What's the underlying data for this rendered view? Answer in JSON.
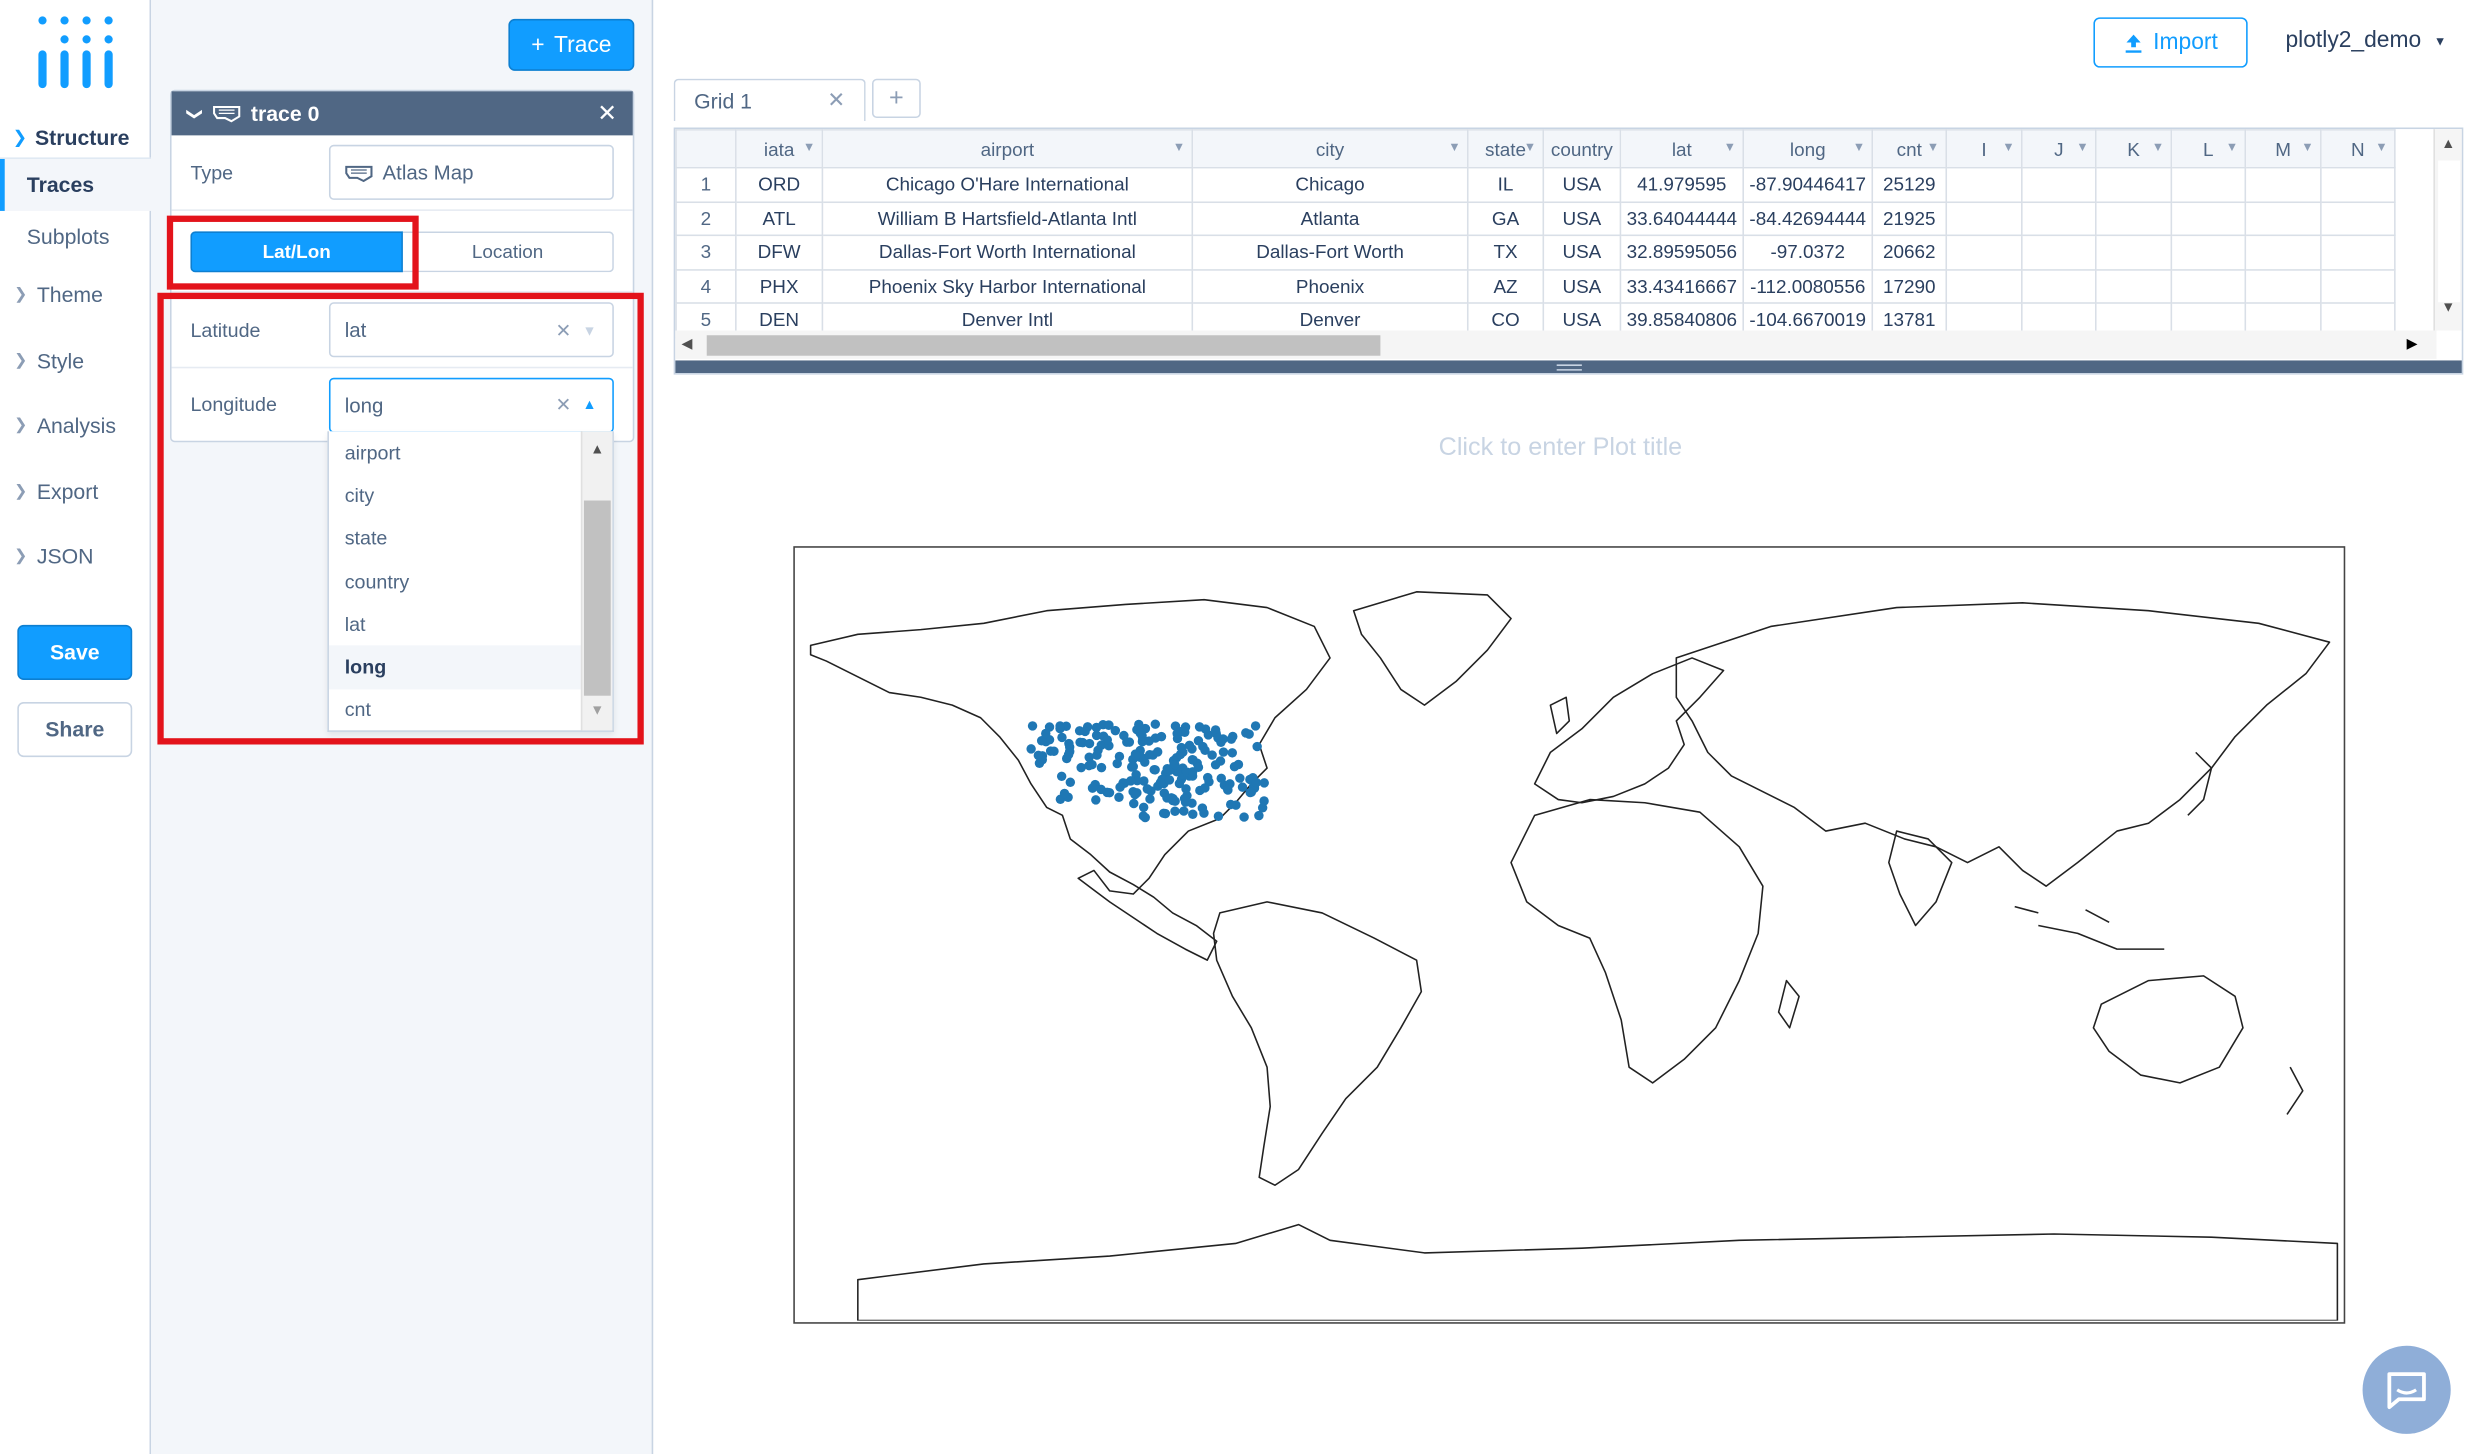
{
  "nav": {
    "structure_label": "Structure",
    "traces_label": "Traces",
    "subplots_label": "Subplots",
    "items": [
      {
        "label": "Theme"
      },
      {
        "label": "Style"
      },
      {
        "label": "Analysis"
      },
      {
        "label": "Export"
      },
      {
        "label": "JSON"
      }
    ],
    "save_label": "Save",
    "share_label": "Share"
  },
  "panel": {
    "add_trace_label": "Trace",
    "trace_title": "trace 0",
    "type_label": "Type",
    "type_value": "Atlas Map",
    "mode_on": "Lat/Lon",
    "mode_off": "Location",
    "latitude_label": "Latitude",
    "latitude_value": "lat",
    "longitude_label": "Longitude",
    "longitude_value": "long",
    "options": [
      "airport",
      "city",
      "state",
      "country",
      "lat",
      "long",
      "cnt"
    ],
    "selected_option": "long"
  },
  "topbar": {
    "import_label": "Import",
    "user_label": "plotly2_demo"
  },
  "grid": {
    "tab_label": "Grid 1",
    "columns": [
      "iata",
      "airport",
      "city",
      "state",
      "country",
      "lat",
      "long",
      "cnt",
      "I",
      "J",
      "K",
      "L",
      "M",
      "N"
    ],
    "rows": [
      [
        "1",
        "ORD",
        "Chicago O'Hare International",
        "Chicago",
        "IL",
        "USA",
        "41.979595",
        "-87.90446417",
        "25129"
      ],
      [
        "2",
        "ATL",
        "William B Hartsfield-Atlanta Intl",
        "Atlanta",
        "GA",
        "USA",
        "33.64044444",
        "-84.42694444",
        "21925"
      ],
      [
        "3",
        "DFW",
        "Dallas-Fort Worth International",
        "Dallas-Fort Worth",
        "TX",
        "USA",
        "32.89595056",
        "-97.0372",
        "20662"
      ],
      [
        "4",
        "PHX",
        "Phoenix Sky Harbor International",
        "Phoenix",
        "AZ",
        "USA",
        "33.43416667",
        "-112.0080556",
        "17290"
      ],
      [
        "5",
        "DEN",
        "Denver Intl",
        "Denver",
        "CO",
        "USA",
        "39.85840806",
        "-104.6670019",
        "13781"
      ]
    ]
  },
  "plot": {
    "title_placeholder": "Click to enter Plot title",
    "marker_color": "#1f77b4"
  },
  "colors": {
    "accent": "#119dff",
    "highlight": "#e3131b",
    "panel_header": "#506784"
  }
}
